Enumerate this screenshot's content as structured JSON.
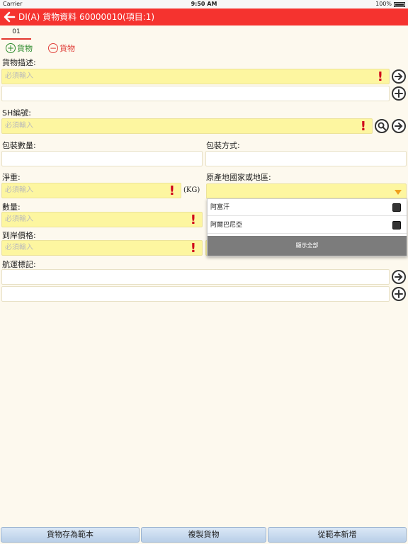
{
  "statusbar": {
    "carrier": "Carrier",
    "time": "9:50 AM",
    "battery": "100%"
  },
  "navbar": {
    "title": "DI(A) 貨物資料 60000010(項目:1)"
  },
  "tabs": [
    "01"
  ],
  "adders": {
    "add_label": "貨物",
    "remove_label": "貨物"
  },
  "form": {
    "desc_label": "貨物描述:",
    "required_placeholder": "必須輸入",
    "sh_label": "SH編號:",
    "pkg_qty_label": "包裝數量:",
    "pkg_method_label": "包裝方式:",
    "net_weight_label": "淨重:",
    "kg_unit": "(KG)",
    "origin_label": "原產地國家或地區:",
    "qty_label": "數量:",
    "price_label": "到岸價格:",
    "marks_label": "航運標記:"
  },
  "origin_dropdown": {
    "options": [
      "阿富汗",
      "阿爾巴尼亞"
    ],
    "show_all": "顯示全部"
  },
  "bottom": {
    "save_template": "貨物存為範本",
    "copy_goods": "複製貨物",
    "new_from_template": "從範本新增"
  }
}
